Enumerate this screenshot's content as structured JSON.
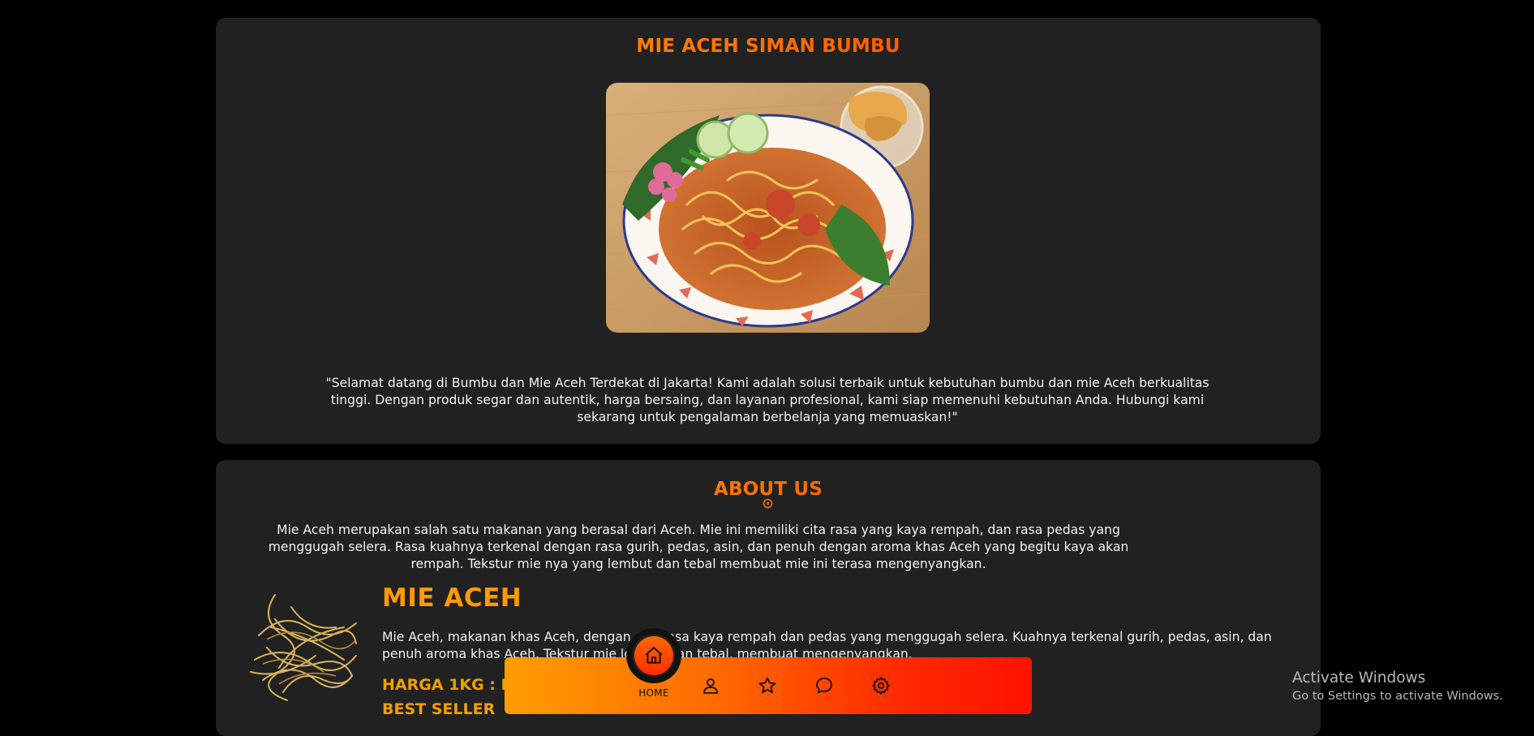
{
  "hero": {
    "title": "MIE ACEH SIMAN BUMBU",
    "intro": "\"Selamat datang di Bumbu dan Mie Aceh Terdekat di Jakarta! Kami adalah solusi terbaik untuk kebutuhan bumbu dan mie Aceh berkualitas tinggi. Dengan produk segar dan autentik, harga bersaing, dan layanan profesional, kami siap memenuhi kebutuhan Anda. Hubungi kami sekarang untuk pengalaman berbelanja yang memuaskan!\""
  },
  "about": {
    "title": "ABOUT US",
    "text": "Mie Aceh merupakan salah satu makanan yang berasal dari Aceh. Mie ini memiliki cita rasa yang kaya rempah, dan rasa pedas yang menggugah selera. Rasa kuahnya terkenal dengan rasa gurih, pedas, asin, dan penuh dengan aroma khas Aceh yang begitu kaya akan rempah. Tekstur mie nya yang lembut dan tebal membuat mie ini terasa mengenyangkan.",
    "product": {
      "title": "MIE ACEH",
      "description": "Mie Aceh, makanan khas Aceh, dengan cita rasa kaya rempah dan pedas yang menggugah selera. Kuahnya terkenal gurih, pedas, asin, dan penuh aroma khas Aceh. Tekstur mie lembut dan tebal, membuat mengenyangkan.",
      "price": "HARGA 1KG : RP.",
      "badge": "BEST SELLER"
    }
  },
  "nav": {
    "home_label": "HOME",
    "items": [
      "home-icon",
      "user-icon",
      "star-icon",
      "chat-icon",
      "settings-icon"
    ],
    "gradient": [
      "#ff9d00",
      "#ff1100"
    ]
  },
  "watermark": {
    "title": "Activate Windows",
    "subtitle": "Go to Settings to activate Windows."
  },
  "colors": {
    "background": "#000000",
    "card": "#212121",
    "accent_orange": "#ff9c00",
    "accent_red": "#ff1e00"
  }
}
